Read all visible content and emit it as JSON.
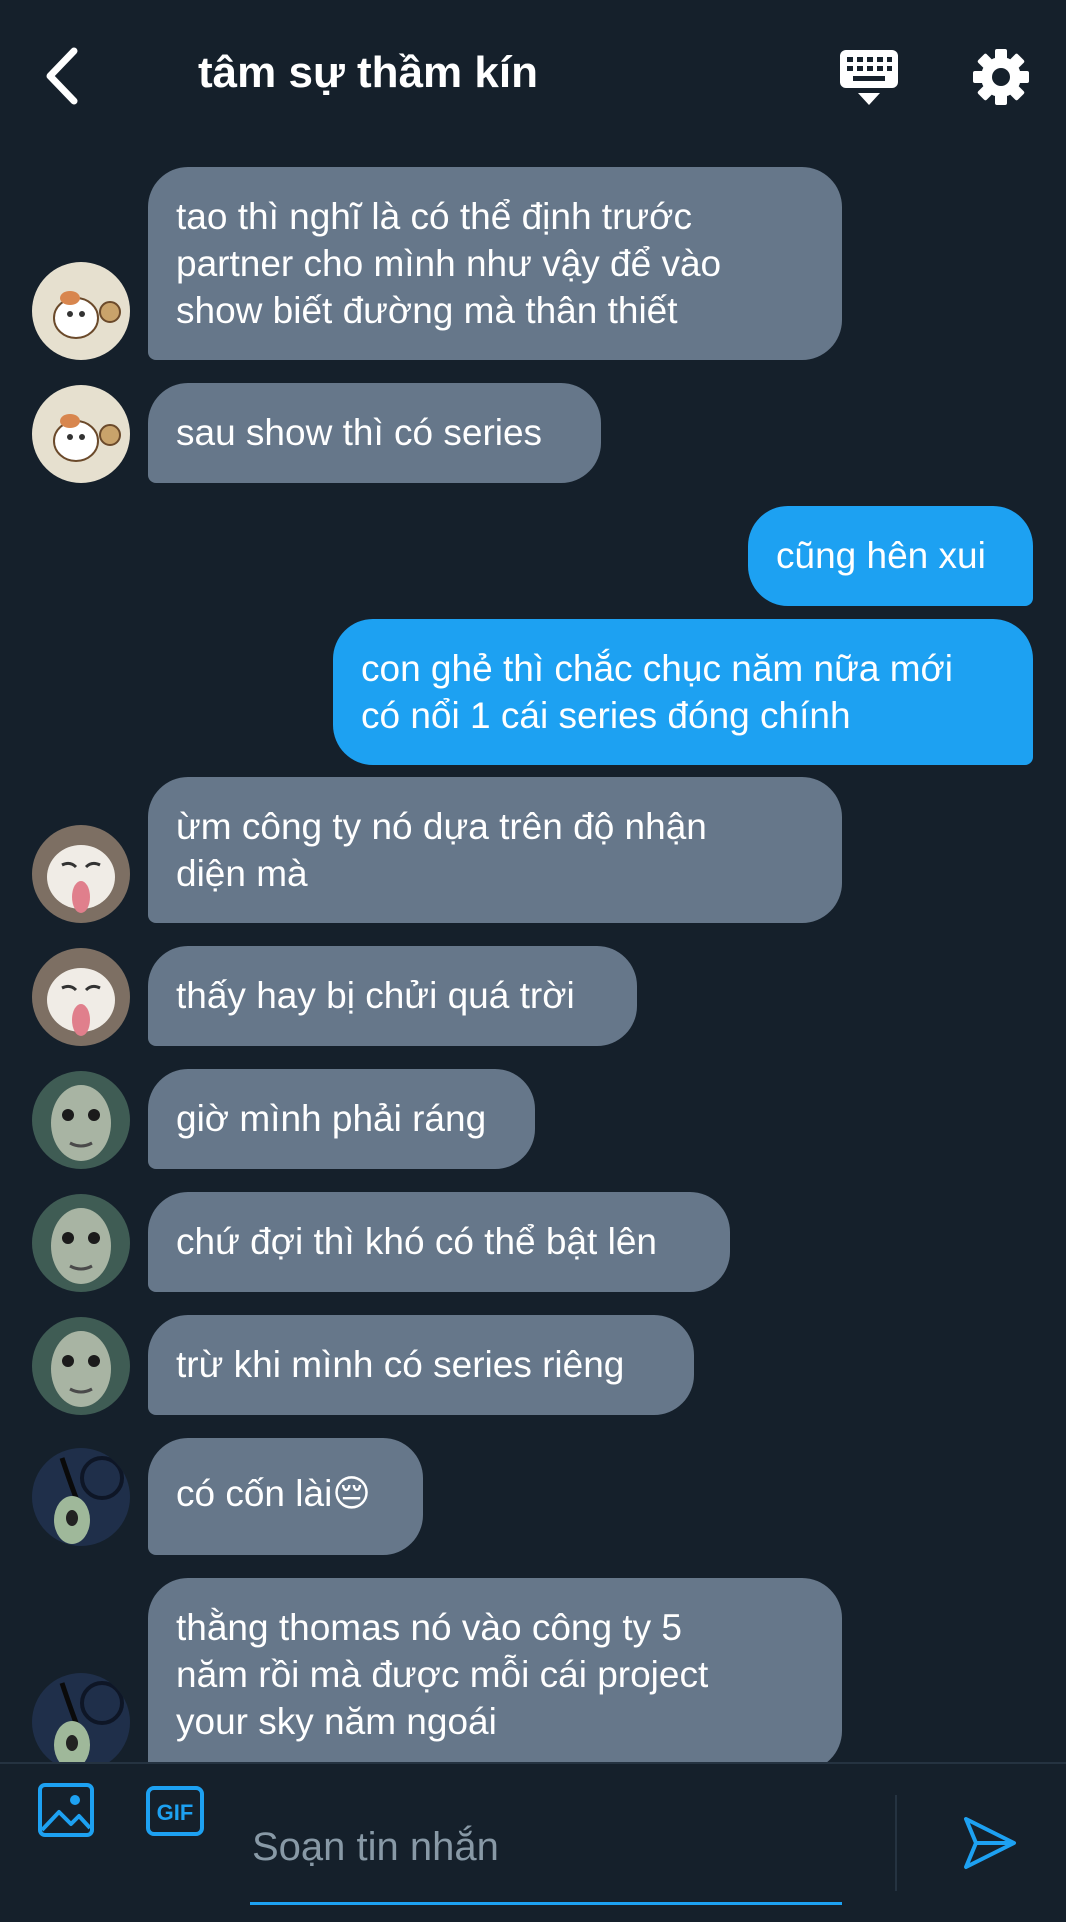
{
  "header": {
    "title": "tâm sự thầm kín",
    "back_icon": "chevron-left-icon",
    "keyboard_icon": "keyboard-icon",
    "settings_icon": "gear-icon"
  },
  "messages": [
    {
      "direction": "in",
      "lines": [
        "tao thì nghĩ là có thể định trước",
        "partner cho mình như vậy để vào",
        "show biết đường mà thân thiết"
      ],
      "avatar": "hamster-avatar"
    },
    {
      "direction": "in",
      "lines": [
        "sau show thì có series"
      ],
      "avatar": "hamster-avatar"
    },
    {
      "direction": "out",
      "lines": [
        "cũng hên xui"
      ]
    },
    {
      "direction": "out",
      "lines": [
        "con ghẻ thì chắc chục năm nữa mới",
        "có nổi 1 cái series đóng chính"
      ]
    },
    {
      "direction": "in",
      "lines": [
        "ừm công ty nó dựa trên độ nhận",
        "diện mà"
      ],
      "avatar": "cat-avatar"
    },
    {
      "direction": "in",
      "lines": [
        "thấy hay bị chửi quá trời"
      ],
      "avatar": "cat-avatar"
    },
    {
      "direction": "in",
      "lines": [
        "giờ mình phải ráng"
      ],
      "avatar": "fish-avatar"
    },
    {
      "direction": "in",
      "lines": [
        "chứ đợi thì khó có thể bật lên"
      ],
      "avatar": "fish-avatar"
    },
    {
      "direction": "in",
      "lines": [
        "trừ khi mình có series riêng"
      ],
      "avatar": "fish-avatar"
    },
    {
      "direction": "in",
      "lines": [
        "có cốn lài😔"
      ],
      "avatar": "squidward-avatar"
    },
    {
      "direction": "in",
      "lines": [
        "thằng thomas nó vào công ty 5",
        "năm rồi mà được mỗi cái project",
        "your sky năm ngoái"
      ],
      "avatar": "squidward-avatar"
    }
  ],
  "composer": {
    "placeholder": "Soạn tin nhắn",
    "media_icon": "image-icon",
    "gif_icon": "gif-icon",
    "gif_label": "GIF",
    "send_icon": "send-icon"
  },
  "colors": {
    "background": "#15202b",
    "incoming_bubble": "#66778a",
    "outgoing_bubble": "#1da1f2",
    "accent": "#1da1f2"
  }
}
